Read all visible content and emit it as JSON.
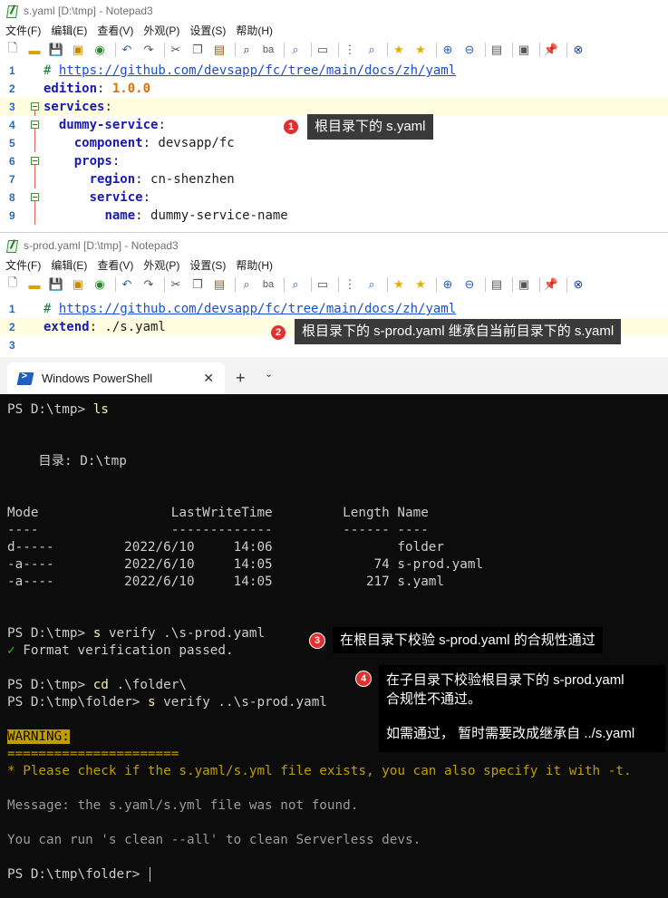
{
  "notepad1": {
    "title": "s.yaml [D:\\tmp] - Notepad3",
    "menu": [
      "文件(F)",
      "编辑(E)",
      "查看(V)",
      "外观(P)",
      "设置(S)",
      "帮助(H)"
    ],
    "lines": [
      {
        "n": "1",
        "parts": [
          [
            "c-comment",
            "# "
          ],
          [
            "c-link",
            "https://github.com/devsapp/fc/tree/main/docs/zh/yaml"
          ]
        ]
      },
      {
        "n": "2",
        "parts": [
          [
            "c-key",
            "edition"
          ],
          [
            "c-str",
            ": "
          ],
          [
            "c-num",
            "1.0.0"
          ]
        ]
      },
      {
        "n": "3",
        "parts": [
          [
            "c-key",
            "services"
          ],
          [
            "c-str",
            ":"
          ]
        ]
      },
      {
        "n": "4",
        "parts": [
          [
            "c-str",
            "  "
          ],
          [
            "c-key",
            "dummy-service"
          ],
          [
            "c-str",
            ":"
          ]
        ]
      },
      {
        "n": "5",
        "parts": [
          [
            "c-str",
            "    "
          ],
          [
            "c-key",
            "component"
          ],
          [
            "c-str",
            ": devsapp/fc"
          ]
        ]
      },
      {
        "n": "6",
        "parts": [
          [
            "c-str",
            "    "
          ],
          [
            "c-key",
            "props"
          ],
          [
            "c-str",
            ":"
          ]
        ]
      },
      {
        "n": "7",
        "parts": [
          [
            "c-str",
            "      "
          ],
          [
            "c-key",
            "region"
          ],
          [
            "c-str",
            ": cn-shenzhen"
          ]
        ]
      },
      {
        "n": "8",
        "parts": [
          [
            "c-str",
            "      "
          ],
          [
            "c-key",
            "service"
          ],
          [
            "c-str",
            ":"
          ]
        ]
      },
      {
        "n": "9",
        "parts": [
          [
            "c-str",
            "        "
          ],
          [
            "c-key",
            "name"
          ],
          [
            "c-str",
            ": dummy-service-name"
          ]
        ]
      }
    ]
  },
  "notepad2": {
    "title": "s-prod.yaml [D:\\tmp] - Notepad3",
    "menu": [
      "文件(F)",
      "编辑(E)",
      "查看(V)",
      "外观(P)",
      "设置(S)",
      "帮助(H)"
    ],
    "lines": [
      {
        "n": "1",
        "parts": [
          [
            "c-comment",
            "# "
          ],
          [
            "c-link",
            "https://github.com/devsapp/fc/tree/main/docs/zh/yaml"
          ]
        ]
      },
      {
        "n": "2",
        "parts": [
          [
            "c-key",
            "extend"
          ],
          [
            "c-str",
            ": ./s.yaml"
          ]
        ]
      },
      {
        "n": "3",
        "parts": []
      }
    ]
  },
  "annotations": {
    "n1": {
      "badge": "1",
      "text": "根目录下的 s.yaml"
    },
    "n2": {
      "badge": "2",
      "text": "根目录下的 s-prod.yaml 继承自当前目录下的 s.yaml"
    },
    "n3": {
      "badge": "3",
      "text": "在根目录下校验 s-prod.yaml 的合规性通过"
    },
    "n4": {
      "badge": "4",
      "line1": "在子目录下校验根目录下的 s-prod.yaml",
      "line2": "合规性不通过。",
      "line3": "如需通过， 暂时需要改成继承自 ../s.yaml"
    }
  },
  "powershell": {
    "tab_title": "Windows PowerShell",
    "lines": {
      "l1_prompt": "PS D:\\tmp> ",
      "l1_cmd": "ls",
      "dir_label": "    目录: D:\\tmp",
      "header": "Mode                 LastWriteTime         Length Name",
      "dashes": "----                 -------------         ------ ----",
      "row1": "d-----         2022/6/10     14:06                folder",
      "row2": "-a----         2022/6/10     14:05             74 s-prod.yaml",
      "row3": "-a----         2022/6/10     14:05            217 s.yaml",
      "l2_prompt": "PS D:\\tmp> ",
      "l2_cmd": "s",
      "l2_arg": " verify .\\s-prod.yaml",
      "ok_mark": "✓",
      "ok_text": " Format verification passed.",
      "l3_prompt": "PS D:\\tmp> ",
      "l3_cmd": "cd",
      "l3_arg": " .\\folder\\",
      "l4_prompt": "PS D:\\tmp\\folder> ",
      "l4_cmd": "s",
      "l4_arg": " verify ..\\s-prod.yaml",
      "warning": "WARNING:",
      "equals": "======================",
      "hint": "* Please check if the s.yaml/s.yml file exists, you can also specify it with -t.",
      "message": "Message: the s.yaml/s.yml file was not found.",
      "clean": "You can run 's clean --all' to clean Serverless devs.",
      "final_prompt": "PS D:\\tmp\\folder> "
    }
  }
}
